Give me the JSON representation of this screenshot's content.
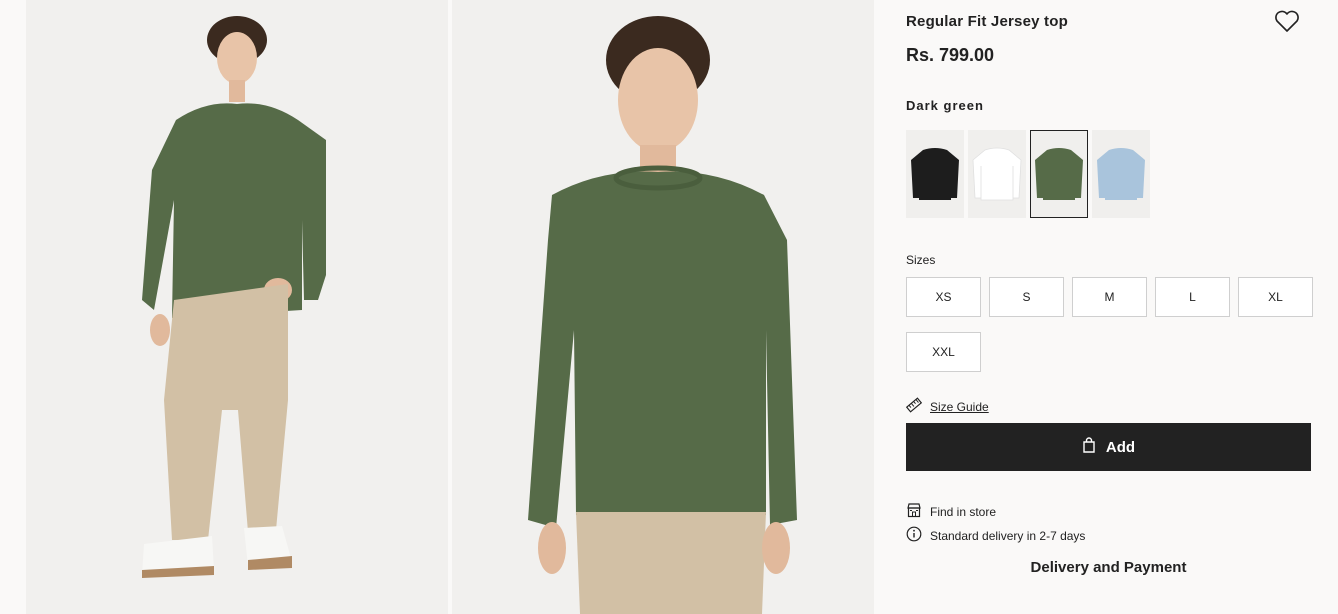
{
  "product": {
    "title": "Regular Fit Jersey top",
    "price": "Rs. 799.00",
    "color_name": "Dark green",
    "swatches": [
      {
        "name": "black",
        "color": "#1d1d1d"
      },
      {
        "name": "white",
        "color": "#ffffff"
      },
      {
        "name": "dark-green",
        "color": "#566b48",
        "selected": true
      },
      {
        "name": "light-blue",
        "color": "#a9c4dc"
      }
    ]
  },
  "sizes": {
    "label": "Sizes",
    "options": [
      "XS",
      "S",
      "M",
      "L",
      "XL",
      "XXL"
    ]
  },
  "size_guide": "Size Guide",
  "add_button": "Add",
  "find_in_store": "Find in store",
  "delivery": "Standard delivery in 2-7 days",
  "delivery_payment": "Delivery and Payment",
  "icons": {
    "wishlist": "heart-icon",
    "size_guide": "ruler-icon",
    "add": "bag-icon",
    "store": "store-icon",
    "info": "info-icon"
  },
  "colors": {
    "shirt": "#566b48",
    "pants": "#d2c0a5",
    "button": "#222222"
  }
}
